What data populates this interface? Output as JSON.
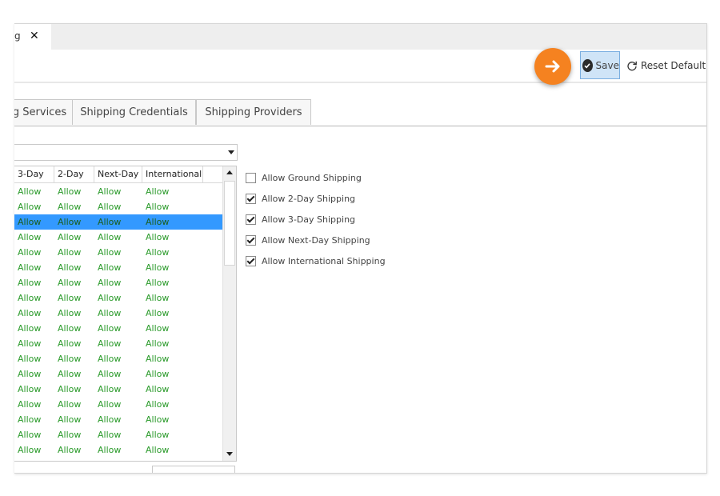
{
  "tab": {
    "title": "g",
    "close": "✕"
  },
  "toolbar": {
    "save_label": "Save",
    "reset_label": "Reset Default"
  },
  "tabs": [
    {
      "label": "g Services"
    },
    {
      "label": "Shipping Credentials"
    },
    {
      "label": "Shipping Providers"
    }
  ],
  "grid": {
    "columns": [
      "3-Day",
      "2-Day",
      "Next-Day",
      "International"
    ],
    "cell_value": "Allow",
    "row_count": 18,
    "selected_row": 3
  },
  "options": [
    {
      "label": "Allow Ground Shipping",
      "checked": false
    },
    {
      "label": "Allow 2-Day Shipping",
      "checked": true
    },
    {
      "label": "Allow 3-Day Shipping",
      "checked": true
    },
    {
      "label": "Allow Next-Day Shipping",
      "checked": true
    },
    {
      "label": "Allow International Shipping",
      "checked": true
    }
  ],
  "colors": {
    "accent": "#f58220",
    "selection": "#3399ff",
    "allow_text": "#2a9a2a"
  },
  "icons": {
    "save": "check-circle-icon",
    "reset": "refresh-icon",
    "callout": "arrow-right-icon"
  }
}
